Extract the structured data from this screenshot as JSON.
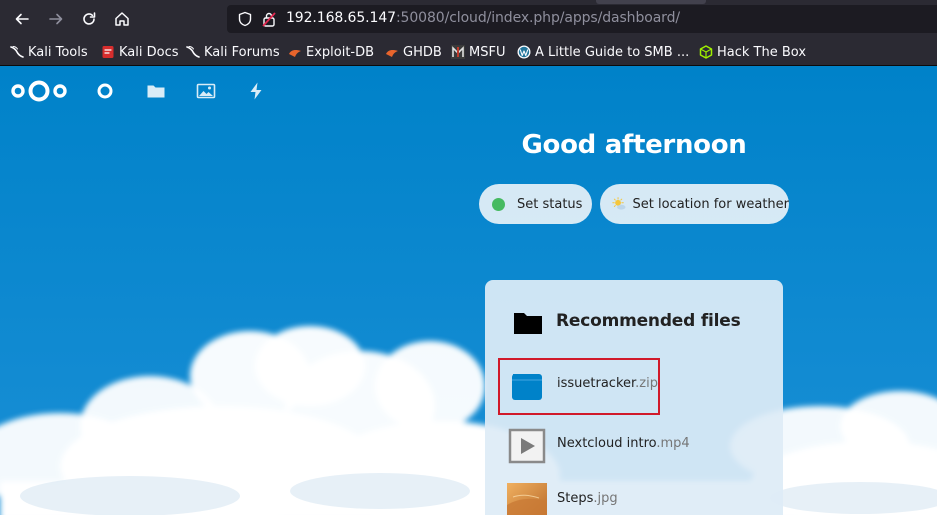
{
  "browser": {
    "url_host": "192.168.65.147",
    "url_rest": ":50080/cloud/index.php/apps/dashboard/",
    "bookmarks": [
      {
        "label": "Kali Tools",
        "icon": "kali-dragon-icon"
      },
      {
        "label": "Kali Docs",
        "icon": "kali-docs-icon"
      },
      {
        "label": "Kali Forums",
        "icon": "kali-dragon-icon"
      },
      {
        "label": "Exploit-DB",
        "icon": "exploit-db-icon"
      },
      {
        "label": "GHDB",
        "icon": "ghdb-icon"
      },
      {
        "label": "MSFU",
        "icon": "msfu-icon"
      },
      {
        "label": "A Little Guide to SMB ...",
        "icon": "wordpress-icon"
      },
      {
        "label": "Hack The Box",
        "icon": "hack-the-box-icon"
      }
    ]
  },
  "nextcloud": {
    "apps": [
      "dashboard-icon",
      "files-icon",
      "photos-icon",
      "activity-icon"
    ],
    "greeting": "Good afternoon",
    "set_status_label": "Set status",
    "weather_label": "Set location for weather",
    "recommended": {
      "title": "Recommended files",
      "files": [
        {
          "base": "issuetracker",
          "ext": ".zip",
          "icon": "zip-folder-icon",
          "highlighted": true
        },
        {
          "base": "Nextcloud intro",
          "ext": ".mp4",
          "icon": "video-file-icon",
          "highlighted": false
        },
        {
          "base": "Steps",
          "ext": ".jpg",
          "icon": "image-thumbnail",
          "highlighted": false
        }
      ]
    }
  },
  "colors": {
    "nextcloud_blue": "#0082c9",
    "status_online": "#46ba61",
    "highlight_red": "#d11a2a"
  }
}
